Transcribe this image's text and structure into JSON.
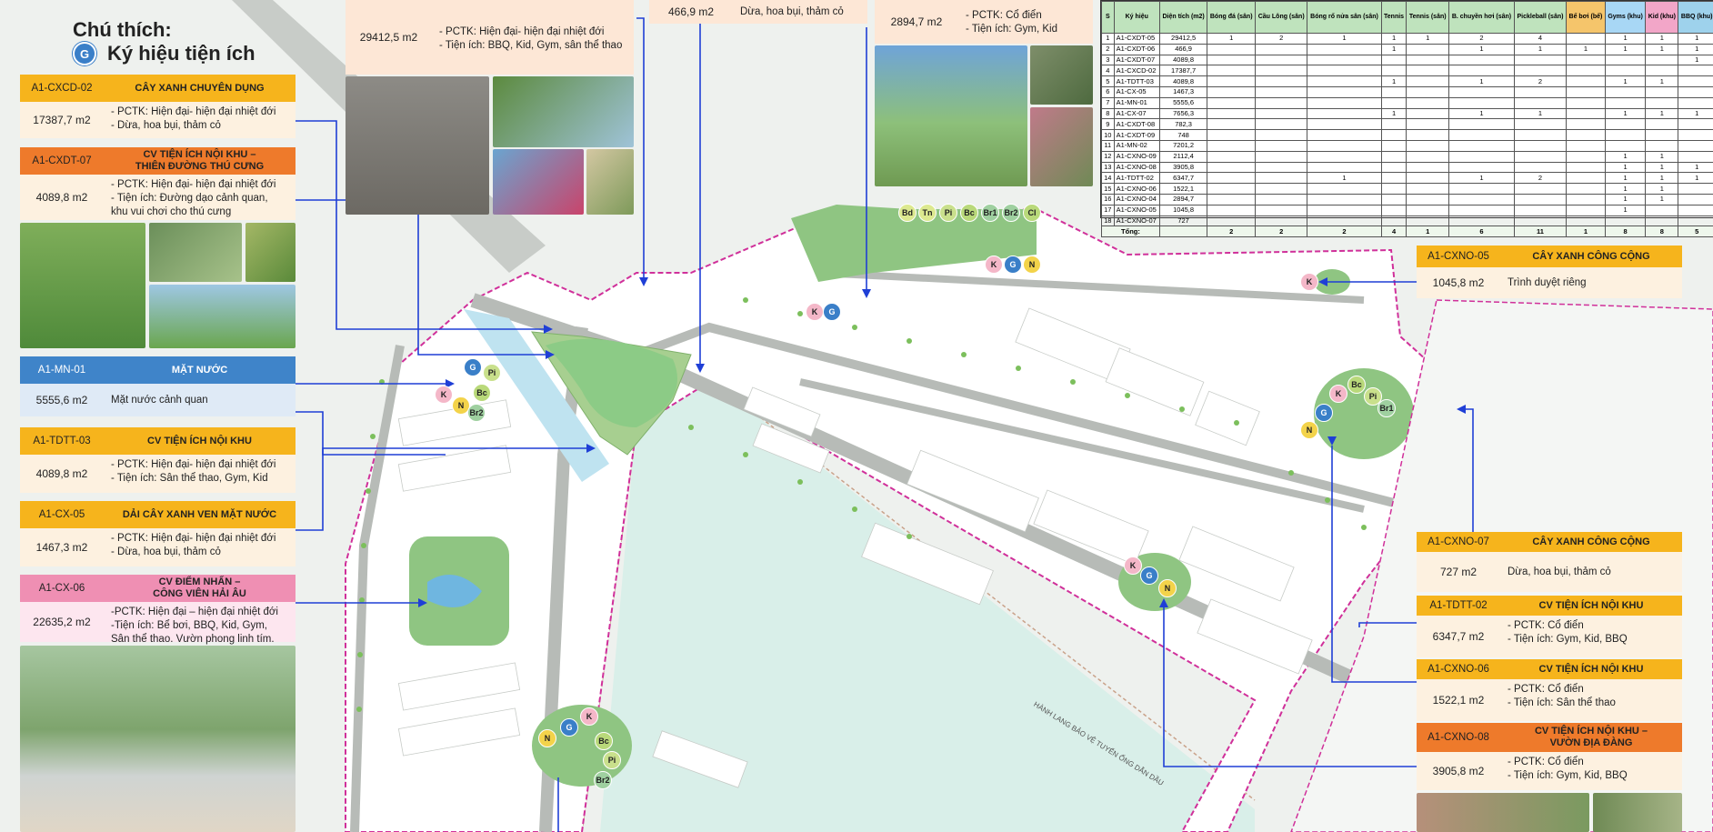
{
  "legend": {
    "title": "Chú thích:",
    "subtitle": "Ký hiệu tiện ích",
    "symbol": "G"
  },
  "cards": {
    "cxcd02": {
      "code": "A1-CXCD-02",
      "name": "CÂY XANH CHUYÊN DỤNG",
      "area": "17387,7 m2",
      "l1": "- PCTK: Hiện đại- hiện đại nhiệt đới",
      "l2": "- Dừa, hoa bụi, thảm cỏ"
    },
    "cxdt07": {
      "code": "A1-CXDT-07",
      "name1": "CV TIỆN ÍCH NỘI KHU –",
      "name2": "THIÊN ĐƯỜNG THÚ CƯNG",
      "area": "4089,8 m2",
      "l1": "- PCTK: Hiện đại- hiện đại nhiệt đới",
      "l2": "- Tiện ích: Đường dạo cảnh quan,",
      "l3": "khu vui chơi cho thú cưng"
    },
    "mn01": {
      "code": "A1-MN-01",
      "name": "MẶT NƯỚC",
      "area": "5555,6 m2",
      "l1": "Mặt nước cảnh quan"
    },
    "tdtt03": {
      "code": "A1-TDTT-03",
      "name": "CV TIỆN ÍCH NỘI KHU",
      "area": "4089,8 m2",
      "l1": "- PCTK: Hiện đại- hiện đại nhiệt đới",
      "l2": "- Tiện ích: Sân thể thao, Gym, Kid"
    },
    "cx05": {
      "code": "A1-CX-05",
      "name": "DẢI CÂY XANH VEN MẶT NƯỚC",
      "area": "1467,3 m2",
      "l1": "- PCTK: Hiện đại- hiện đại nhiệt đới",
      "l2": "- Dừa, hoa bụi, thảm cỏ"
    },
    "cx06": {
      "code": "A1-CX-06",
      "name1": "CV ĐIỂM NHẤN –",
      "name2": "CÔNG VIÊN HẢI ÂU",
      "area": "22635,2 m2",
      "l1": "-PCTK: Hiện đại – hiện đại nhiệt đới",
      "l2": "-Tiện ích: Bể bơi, BBQ, Kid, Gym,",
      "l3": "Sân thể thao. Vườn phong linh tím."
    },
    "top1": {
      "area": "29412,5 m2",
      "l1": "- PCTK: Hiện đại- hiện đại nhiệt đới",
      "l2": "- Tiện ích: BBQ, Kid, Gym, sân thể thao"
    },
    "top2": {
      "area": "466,9 m2",
      "l1": "Dừa, hoa bụi, thảm cỏ"
    },
    "top3": {
      "area": "2894,7 m2",
      "l1": "- PCTK: Cổ điển",
      "l2": "- Tiện ích: Gym, Kid"
    },
    "cxno05": {
      "code": "A1-CXNO-05",
      "name": "CÂY XANH CÔNG CỘNG",
      "area": "1045,8 m2",
      "l1": "Trình duyệt riêng"
    },
    "cxno07": {
      "code": "A1-CXNO-07",
      "name": "CÂY XANH CÔNG CỘNG",
      "area": "727 m2",
      "l1": "Dừa, hoa bụi, thảm cỏ"
    },
    "tdtt02": {
      "code": "A1-TDTT-02",
      "name": "CV TIỆN ÍCH NỘI KHU",
      "area": "6347,7 m2",
      "l1": "- PCTK: Cổ điển",
      "l2": "- Tiện ích: Gym, Kid, BBQ"
    },
    "cxno06": {
      "code": "A1-CXNO-06",
      "name": "CV TIỆN ÍCH NỘI KHU",
      "area": "1522,1 m2",
      "l1": "- PCTK: Cổ điển",
      "l2": "- Tiện ích: Sân thể thao"
    },
    "cxno08": {
      "code": "A1-CXNO-08",
      "name1": "CV TIỆN ÍCH NỘI KHU –",
      "name2": "VƯỜN ĐỊA ĐÀNG",
      "area": "3905,8 m2",
      "l1": "- PCTK: Cổ điển",
      "l2": "- Tiện ích: Gym, Kid, BBQ"
    }
  },
  "table": {
    "headers": [
      "S",
      "Ký hiệu",
      "Diện tích (m2)",
      "Bóng đá (sân)",
      "Cầu Lông (sân)",
      "Bóng rổ nửa sân (sân)",
      "Tennis",
      "Tennis (sân)",
      "B. chuyền hơi (sân)",
      "Pickleball (sân)",
      "Bể bơi (bể)",
      "Gyms (khu)",
      "Kid (khu)",
      "BBQ (khu)"
    ],
    "rows": [
      [
        "1",
        "A1-CXDT-05",
        "29412,5",
        "1",
        "2",
        "1",
        "1",
        "1",
        "2",
        "4",
        "",
        "1",
        "1",
        "1"
      ],
      [
        "2",
        "A1-CXDT-06",
        "466,9",
        "",
        "",
        "",
        "1",
        "",
        "1",
        "1",
        "1",
        "1",
        "1",
        "1"
      ],
      [
        "3",
        "A1-CXDT-07",
        "4089,8",
        "",
        "",
        "",
        "",
        "",
        "",
        "",
        "",
        "",
        "",
        "1"
      ],
      [
        "4",
        "A1-CXCD-02",
        "17387,7",
        "",
        "",
        "",
        "",
        "",
        "",
        "",
        "",
        "",
        "",
        ""
      ],
      [
        "5",
        "A1-TDTT-03",
        "4089,8",
        "",
        "",
        "",
        "1",
        "",
        "1",
        "2",
        "",
        "1",
        "1",
        ""
      ],
      [
        "6",
        "A1-CX-05",
        "1467,3",
        "",
        "",
        "",
        "",
        "",
        "",
        "",
        "",
        "",
        "",
        ""
      ],
      [
        "7",
        "A1-MN-01",
        "5555,6",
        "",
        "",
        "",
        "",
        "",
        "",
        "",
        "",
        "",
        "",
        ""
      ],
      [
        "8",
        "A1-CX-07",
        "7656,3",
        "",
        "",
        "",
        "1",
        "",
        "1",
        "1",
        "",
        "1",
        "1",
        "1"
      ],
      [
        "9",
        "A1-CXDT-08",
        "782,3",
        "",
        "",
        "",
        "",
        "",
        "",
        "",
        "",
        "",
        "",
        ""
      ],
      [
        "10",
        "A1-CXDT-09",
        "748",
        "",
        "",
        "",
        "",
        "",
        "",
        "",
        "",
        "",
        "",
        ""
      ],
      [
        "11",
        "A1-MN-02",
        "7201,2",
        "",
        "",
        "",
        "",
        "",
        "",
        "",
        "",
        "",
        "",
        ""
      ],
      [
        "12",
        "A1-CXNO-09",
        "2112,4",
        "",
        "",
        "",
        "",
        "",
        "",
        "",
        "",
        "1",
        "1",
        ""
      ],
      [
        "13",
        "A1-CXNO-08",
        "3905,8",
        "",
        "",
        "",
        "",
        "",
        "",
        "",
        "",
        "1",
        "1",
        "1"
      ],
      [
        "14",
        "A1-TDTT-02",
        "6347,7",
        "",
        "",
        "1",
        "",
        "",
        "1",
        "2",
        "",
        "1",
        "1",
        "1"
      ],
      [
        "15",
        "A1-CXNO-06",
        "1522,1",
        "",
        "",
        "",
        "",
        "",
        "",
        "",
        "",
        "1",
        "1",
        ""
      ],
      [
        "16",
        "A1-CXNO-04",
        "2894,7",
        "",
        "",
        "",
        "",
        "",
        "",
        "",
        "",
        "1",
        "1",
        ""
      ],
      [
        "17",
        "A1-CXNO-05",
        "1045,8",
        "",
        "",
        "",
        "",
        "",
        "",
        "",
        "",
        "1",
        "",
        ""
      ],
      [
        "18",
        "A1-CXNO-07",
        "727",
        "",
        "",
        "",
        "",
        "",
        "",
        "",
        "",
        "",
        "",
        ""
      ]
    ],
    "total": [
      "Tổng:",
      "",
      "2",
      "2",
      "2",
      "4",
      "1",
      "6",
      "11",
      "1",
      "8",
      "8",
      "5"
    ]
  },
  "map_labels": {
    "corridor": "HÀNH LANG BẢO VỆ TUYẾN ỐNG DẪN DẦU"
  },
  "badges": {
    "K": "K",
    "G": "G",
    "N": "N",
    "Bc": "Bc",
    "Pi": "Pi",
    "Br": "Br",
    "Br1": "Br1",
    "Br2": "Br2",
    "Bd": "Bd",
    "Tn": "Tn",
    "Cl": "Cl"
  },
  "colors": {
    "accent_yellow": "#f6b41c",
    "accent_orange": "#ee7a2b",
    "accent_blue": "#3f84c9",
    "accent_pink": "#ef8fb3",
    "boundary": "#d0309a",
    "leader": "#1f3fd6"
  }
}
